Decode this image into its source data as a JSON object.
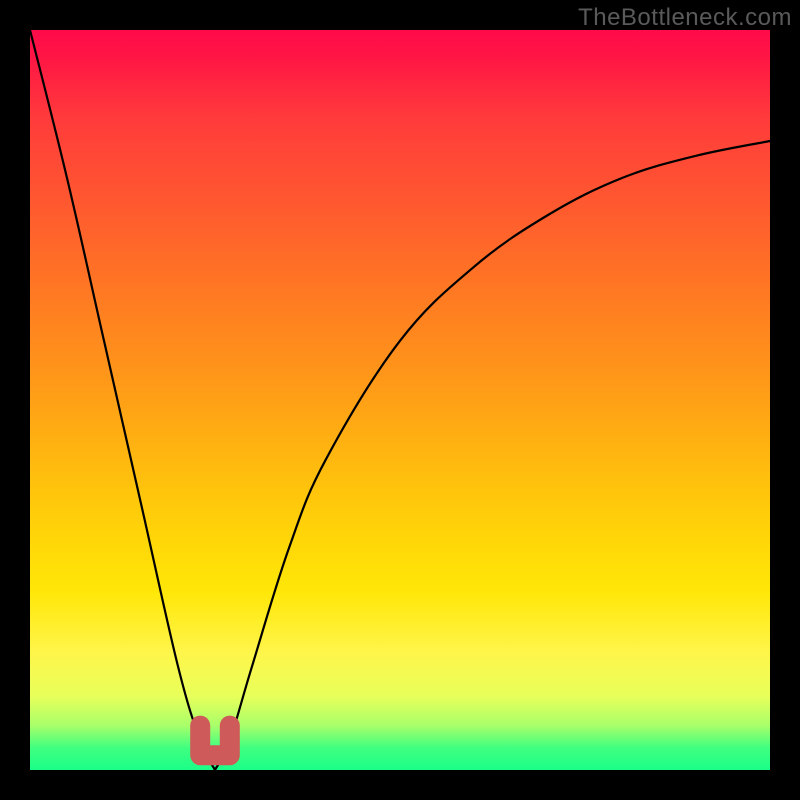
{
  "watermark": "TheBottleneck.com",
  "chart_data": {
    "type": "line",
    "title": "",
    "xlabel": "",
    "ylabel": "",
    "xlim": [
      0,
      100
    ],
    "ylim": [
      0,
      100
    ],
    "grid": false,
    "legend": false,
    "description": "Bottleneck-percentage style curve with a single sharp minimum near x≈25, rising steeply toward the left edge (~100 at x=0) and asymptotically toward ~85 on the right edge. A short U-shaped marker highlights the minimum region.",
    "series": [
      {
        "name": "bottleneck-curve",
        "x": [
          0,
          5,
          10,
          15,
          20,
          23,
          25,
          27,
          30,
          35,
          40,
          50,
          60,
          70,
          80,
          90,
          100
        ],
        "y": [
          100,
          80,
          58,
          36,
          14,
          4,
          0,
          4,
          14,
          30,
          42,
          58,
          68,
          75,
          80,
          83,
          85
        ]
      }
    ],
    "marker": {
      "name": "minimum-highlight",
      "x_range": [
        23,
        27
      ],
      "y": 2,
      "color": "#ce5a5a"
    },
    "gradient_stops": [
      {
        "pos": 0,
        "color": "#ff0a4a"
      },
      {
        "pos": 24,
        "color": "#ff5a2f"
      },
      {
        "pos": 48,
        "color": "#ff9a18"
      },
      {
        "pos": 76,
        "color": "#ffe708"
      },
      {
        "pos": 94,
        "color": "#a8ff6a"
      },
      {
        "pos": 100,
        "color": "#1aff88"
      }
    ]
  }
}
